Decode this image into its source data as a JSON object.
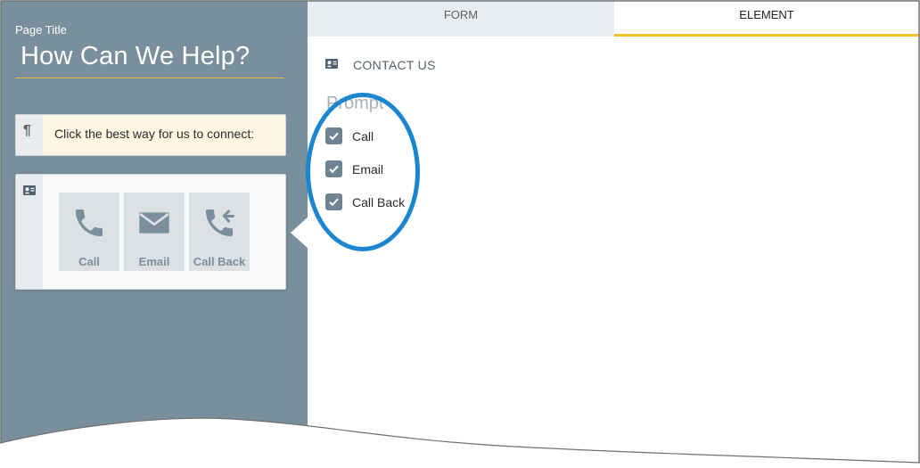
{
  "left": {
    "page_title_label": "Page Title",
    "page_title": "How Can We Help?",
    "text_element": {
      "icon": "pilcrow-icon",
      "label": "Click the best way for us to connect:"
    },
    "contact_element": {
      "icon": "contact-card-icon",
      "options": [
        {
          "label": "Call",
          "icon": "phone-icon"
        },
        {
          "label": "Email",
          "icon": "envelope-icon"
        },
        {
          "label": "Call Back",
          "icon": "phone-callback-icon"
        }
      ]
    }
  },
  "right": {
    "tabs": [
      {
        "label": "FORM",
        "active": false
      },
      {
        "label": "ELEMENT",
        "active": true
      }
    ],
    "section": {
      "icon": "contact-card-icon",
      "title": "CONTACT US"
    },
    "prompt_label": "Prompt",
    "checkboxes": [
      {
        "label": "Call",
        "checked": true
      },
      {
        "label": "Email",
        "checked": true
      },
      {
        "label": "Call Back",
        "checked": true
      }
    ]
  },
  "colors": {
    "panel_bg": "#7a8f9c",
    "accent_yellow": "#f2c12e",
    "annotation_blue": "#1b86cf",
    "checkbox_fill": "#6f8490"
  }
}
